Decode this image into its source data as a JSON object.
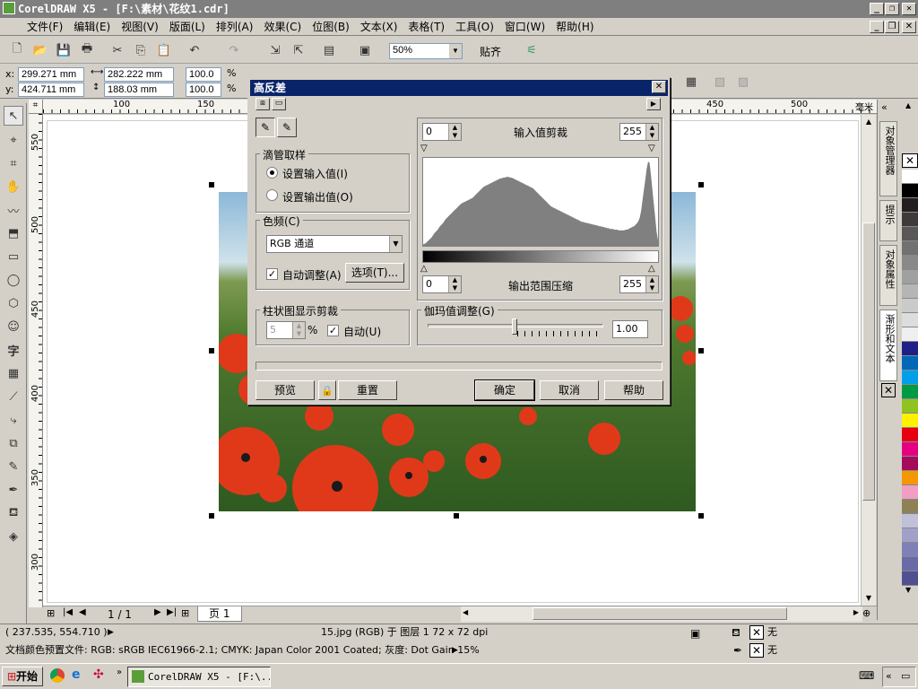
{
  "window": {
    "title": "CorelDRAW X5 - [F:\\素材\\花纹1.cdr]",
    "controls": {
      "minimize": "_",
      "restore": "❐",
      "close": "✕"
    }
  },
  "menu": {
    "items": [
      "文件(F)",
      "编辑(E)",
      "视图(V)",
      "版面(L)",
      "排列(A)",
      "效果(C)",
      "位图(B)",
      "文本(X)",
      "表格(T)",
      "工具(O)",
      "窗口(W)",
      "帮助(H)"
    ]
  },
  "toolbar": {
    "zoom_value": "50%",
    "snap_label": "贴齐"
  },
  "propbar": {
    "x_label": "x:",
    "x_value": "299.271 mm",
    "y_label": "y:",
    "y_value": "424.711 mm",
    "w_value": "282.222 mm",
    "h_value": "188.03 mm",
    "scale_x": "100.0",
    "scale_y": "100.0",
    "pct": "%"
  },
  "ruler": {
    "h_ticks": [
      "100",
      "150",
      "450",
      "500",
      "毫米"
    ],
    "v_ticks": [
      "550",
      "500",
      "450",
      "400",
      "350",
      "300"
    ]
  },
  "dialog": {
    "title": "高反差",
    "eyedropper_group": "滴管取样",
    "radio_input": "设置输入值(I)",
    "radio_output": "设置输出值(O)",
    "channel_group": "色频(C)",
    "channel_value": "RGB 通道",
    "auto_adjust": "自动调整(A)",
    "options_btn": "选项(T)...",
    "clip_group": "柱状图显示剪裁",
    "clip_value": "5",
    "clip_pct": "%",
    "clip_auto": "自动(U)",
    "input_low": "0",
    "input_label": "输入值剪裁",
    "input_high": "255",
    "output_low": "0",
    "output_label": "输出范围压缩",
    "output_high": "255",
    "gamma_group": "伽玛值调整(G)",
    "gamma_value": "1.00",
    "preview_btn": "预览",
    "reset_btn": "重置",
    "ok_btn": "确定",
    "cancel_btn": "取消",
    "help_btn": "帮助"
  },
  "page_nav": {
    "page_count": "1 / 1",
    "page_tab": "页 1"
  },
  "docker_tabs": [
    "对象管理器",
    "提示",
    "对象属性",
    "渐形和文本"
  ],
  "palette": {
    "colors": [
      "#ffffff",
      "#000000",
      "#231f20",
      "#3e3a39",
      "#595757",
      "#727171",
      "#898989",
      "#9fa0a0",
      "#b5b5b6",
      "#c9caca",
      "#dcdddd",
      "#efefef",
      "#1d2088",
      "#0068b7",
      "#00a0e9",
      "#009944",
      "#8fc31f",
      "#fff100",
      "#e60012",
      "#e4007f",
      "#a40b5d",
      "#f39800",
      "#f19ec2",
      "#8f8156",
      "#c0c0d8",
      "#a0a0c8",
      "#8080b8",
      "#6a6aa8",
      "#505090"
    ]
  },
  "status": {
    "coords": "( 237.535, 554.710 )",
    "object_info": "15.jpg (RGB) 于 图层 1 72 x 72 dpi",
    "profile": "文档颜色预置文件: RGB: sRGB IEC61966-2.1; CMYK: Japan Color 2001 Coated; 灰度: Dot Gain 15%",
    "fill_none": "无",
    "outline_none": "无"
  },
  "taskbar": {
    "start": "开始",
    "task": "CorelDRAW X5 - [F:\\..."
  },
  "histogram": [
    2,
    3,
    4,
    6,
    8,
    10,
    12,
    15,
    18,
    20,
    22,
    25,
    28,
    30,
    32,
    35,
    38,
    40,
    42,
    44,
    46,
    48,
    50,
    52,
    54,
    56,
    58,
    60,
    61,
    62,
    63,
    64,
    65,
    66,
    67,
    68,
    70,
    72,
    74,
    76,
    78,
    80,
    82,
    84,
    85,
    86,
    87,
    88,
    89,
    90,
    91,
    92,
    93,
    94,
    95,
    96,
    96,
    97,
    97,
    98,
    98,
    98,
    97,
    97,
    96,
    95,
    94,
    93,
    92,
    91,
    90,
    89,
    88,
    87,
    86,
    85,
    84,
    83,
    82,
    80,
    78,
    76,
    74,
    72,
    70,
    68,
    66,
    64,
    62,
    60,
    58,
    56,
    55,
    54,
    53,
    52,
    51,
    50,
    49,
    48,
    47,
    46,
    45,
    44,
    43,
    42,
    41,
    40,
    39,
    38,
    37,
    36,
    35,
    34,
    34,
    33,
    33,
    32,
    32,
    31,
    31,
    30,
    30,
    29,
    29,
    28,
    28,
    27,
    27,
    26,
    26,
    25,
    25,
    24,
    24,
    24,
    23,
    23,
    23,
    22,
    22,
    22,
    22,
    22,
    23,
    23,
    24,
    25,
    26,
    27,
    28,
    30,
    32,
    35,
    40,
    50,
    65,
    80,
    95,
    110,
    120,
    118,
    100,
    80,
    60,
    40,
    20,
    8
  ]
}
